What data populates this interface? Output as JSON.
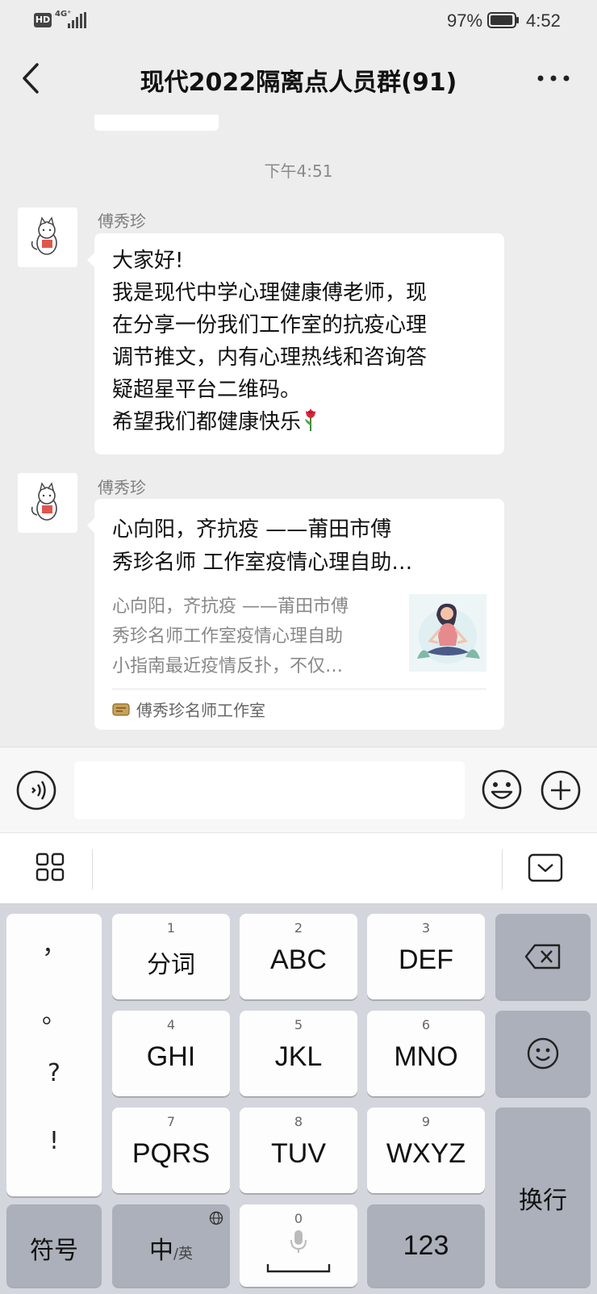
{
  "status_bar": {
    "hd_badge": "HD",
    "network": "4G⁺",
    "battery_percent": "97%",
    "battery_level": 0.97,
    "time": "4:52"
  },
  "nav": {
    "title": "现代2022隔离点人员群(91)",
    "back_icon": "chevron-left-icon",
    "more_icon": "more-dots-icon"
  },
  "chat": {
    "timestamp": "下午4:51",
    "messages": [
      {
        "sender": "傅秀珍",
        "avatar_icon": "cat-avatar-icon",
        "lines": [
          "大家好!",
          "我是现代中学心理健康傅老师，现",
          "在分享一份我们工作室的抗疫心理",
          "调节推文，内有心理热线和咨询答",
          "疑超星平台二维码。",
          "希望我们都健康快乐"
        ],
        "trailing_emoji": "rose-emoji"
      },
      {
        "sender": "傅秀珍",
        "avatar_icon": "cat-avatar-icon",
        "link_card": {
          "title_lines": [
            "心向阳，齐抗疫 ——莆田市傅",
            "秀珍名师 工作室疫情心理自助…"
          ],
          "desc_lines": [
            "心向阳，齐抗疫 ——莆田市傅",
            "秀珍名师工作室疫情心理自助",
            "小指南最近疫情反扑，不仅…"
          ],
          "thumbnail_icon": "meditation-illustration",
          "source": "傅秀珍名师工作室"
        }
      }
    ]
  },
  "input_bar": {
    "voice_icon": "voice-icon",
    "text_value": "",
    "emoji_icon": "emoji-icon",
    "plus_icon": "plus-icon"
  },
  "ime_toolbar": {
    "menu_icon": "grid-menu-icon",
    "hide_icon": "keyboard-hide-icon"
  },
  "keyboard": {
    "punctuation": [
      "，",
      "。",
      "?",
      "!"
    ],
    "keys": [
      {
        "num": "1",
        "label": "分词"
      },
      {
        "num": "2",
        "label": "ABC"
      },
      {
        "num": "3",
        "label": "DEF"
      },
      {
        "num": "4",
        "label": "GHI"
      },
      {
        "num": "5",
        "label": "JKL"
      },
      {
        "num": "6",
        "label": "MNO"
      },
      {
        "num": "7",
        "label": "PQRS"
      },
      {
        "num": "8",
        "label": "TUV"
      },
      {
        "num": "9",
        "label": "WXYZ"
      }
    ],
    "backspace_icon": "backspace-icon",
    "emoji_icon": "smiley-icon",
    "enter_label": "换行",
    "symbol_label": "符号",
    "lang_label_main": "中",
    "lang_label_sub": "/英",
    "space_num": "0",
    "num_label": "123"
  },
  "colors": {
    "background": "#ededed",
    "keyboard_bg": "#d3d6dd",
    "function_key": "#abb0ba"
  }
}
